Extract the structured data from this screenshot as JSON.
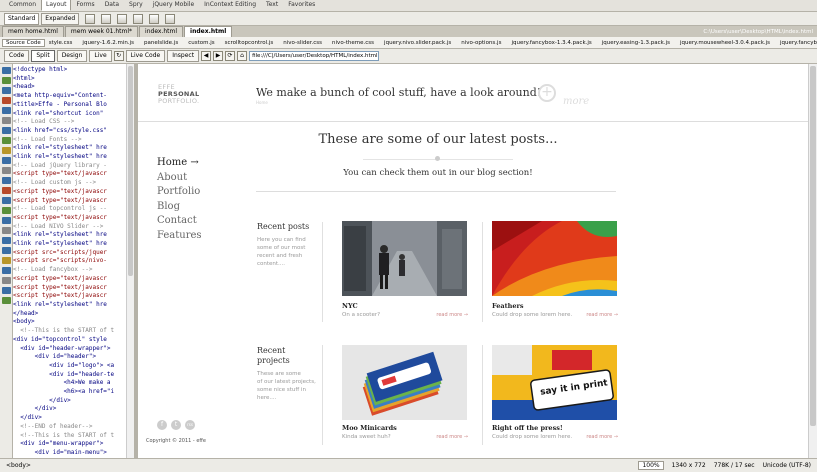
{
  "insert_bar": {
    "tabs": [
      "Common",
      "Layout",
      "Forms",
      "Data",
      "Spry",
      "jQuery Mobile",
      "InContext Editing",
      "Text",
      "Favorites"
    ],
    "active": 1
  },
  "toolrow": {
    "standard": "Standard",
    "expanded": "Expanded"
  },
  "document_tabs": {
    "tabs": [
      "mem home.html",
      "mem week 01.html*",
      "index.html",
      "index.html"
    ],
    "active": 3,
    "path": "C:\\Users\\user\\Desktop\\HTML\\index.html"
  },
  "related_files": [
    "Source Code",
    "style.css",
    "jquery-1.6.2.min.js",
    "panelslide.js",
    "custom.js",
    "scrolltopcontrol.js",
    "nivo-slider.css",
    "nivo-theme.css",
    "jquery.nivo.slider.pack.js",
    "nivo-options.js",
    "jquery.fancybox-1.3.4.pack.js",
    "jquery.easing-1.3.pack.js",
    "jquery.mousewheel-3.0.4.pack.js",
    "jquery.fancybox-1.3.4.css"
  ],
  "doc_toolbar": {
    "code": "Code",
    "split": "Split",
    "design": "Design",
    "live": "Live",
    "live_code": "Live Code",
    "inspect": "Inspect",
    "address": "file:///C|/Users/user/Desktop/HTML/index.html"
  },
  "code_lines": [
    {
      "t": "<!doctype html>",
      "c": "tag"
    },
    {
      "t": "<html>",
      "c": "tag"
    },
    {
      "t": "<head>",
      "c": "tag"
    },
    {
      "t": "<meta http-equiv=\"Content-",
      "c": "tag"
    },
    {
      "t": "<title>Effe - Personal Blo",
      "c": "tag"
    },
    {
      "t": "<link rel=\"shortcut icon\" ",
      "c": "tag"
    },
    {
      "t": "<!-- Load CSS -->",
      "c": "cmt"
    },
    {
      "t": "<link href=\"css/style.css\"",
      "c": "tag"
    },
    {
      "t": "<!-- Load Fonts -->",
      "c": "cmt"
    },
    {
      "t": "<link rel=\"stylesheet\" hre",
      "c": "tag"
    },
    {
      "t": "<link rel=\"stylesheet\" hre",
      "c": "tag"
    },
    {
      "t": "<!-- Load jQuery library -",
      "c": "cmt"
    },
    {
      "t": "<script type=\"text/javascr",
      "c": "red"
    },
    {
      "t": "<!-- Load custom js -->",
      "c": "cmt"
    },
    {
      "t": "<script type=\"text/javascr",
      "c": "red"
    },
    {
      "t": "<script type=\"text/javascr",
      "c": "red"
    },
    {
      "t": "<!-- Load topcontrol js --",
      "c": "cmt"
    },
    {
      "t": "<script type=\"text/javascr",
      "c": "red"
    },
    {
      "t": "<!-- Load NIVO Slider -->",
      "c": "cmt"
    },
    {
      "t": "<link rel=\"stylesheet\" hre",
      "c": "tag"
    },
    {
      "t": "<link rel=\"stylesheet\" hre",
      "c": "tag"
    },
    {
      "t": "<script src=\"scripts/jquer",
      "c": "red"
    },
    {
      "t": "<script src=\"scripts/nivo-",
      "c": "red"
    },
    {
      "t": "<!-- Load fancybox -->",
      "c": "cmt"
    },
    {
      "t": "<script type=\"text/javascr",
      "c": "red"
    },
    {
      "t": "<script type=\"text/javascr",
      "c": "red"
    },
    {
      "t": "<script type=\"text/javascr",
      "c": "red"
    },
    {
      "t": "<link rel=\"stylesheet\" hre",
      "c": "tag"
    },
    {
      "t": "</head>",
      "c": "tag"
    },
    {
      "t": "<body>",
      "c": "tag"
    },
    {
      "t": "  <!--This is the START of t",
      "c": "cmt"
    },
    {
      "t": "<div id=\"topcontrol\" style",
      "c": "tag"
    },
    {
      "t": "  <div id=\"header-wrapper\">",
      "c": "tag"
    },
    {
      "t": "      <div id=\"header\">",
      "c": "tag"
    },
    {
      "t": "          <div id=\"logo\"> <a",
      "c": "tag"
    },
    {
      "t": "          <div id=\"header-te",
      "c": "tag"
    },
    {
      "t": "              <h4>We make a ",
      "c": "tag"
    },
    {
      "t": "              <h6><a href=\"i",
      "c": "tag"
    },
    {
      "t": "          </div>",
      "c": "tag"
    },
    {
      "t": "      </div>",
      "c": "tag"
    },
    {
      "t": "  </div>",
      "c": "tag"
    },
    {
      "t": "  <!--END of header-->",
      "c": "cmt"
    },
    {
      "t": "  <!--This is the START of t",
      "c": "cmt"
    },
    {
      "t": "  <div id=\"menu-wrapper\">",
      "c": "tag"
    },
    {
      "t": "      <div id=\"main-menu\">",
      "c": "tag"
    }
  ],
  "site": {
    "logo": [
      "EFFE",
      "PERSONAL",
      "PORTFOLIO."
    ],
    "tagline": "We make a bunch of cool stuff, have a look around!",
    "tagline_sub": "Home",
    "more": "more",
    "heading": "These are some of our latest posts...",
    "subheading": "You can check them out in our blog section!",
    "nav": [
      "Home →",
      "About",
      "Portfolio",
      "Blog",
      "Contact",
      "Features"
    ],
    "recent_posts": {
      "title": "Recent posts",
      "desc": [
        "Here you can find",
        "some of our most",
        "recent and fresh",
        "content...."
      ]
    },
    "recent_projects": {
      "title": [
        "Recent",
        "projects"
      ],
      "desc": [
        "These are some",
        "of our latest projects,",
        "some nice stuff in",
        "here...."
      ]
    },
    "posts": [
      {
        "title": "NYC",
        "desc": "On a scooter?",
        "more": "read more →"
      },
      {
        "title": "Feathers",
        "desc": "Could drop some lorem here.",
        "more": "read more →"
      }
    ],
    "projects": [
      {
        "title": "Moo Minicards",
        "desc": "Kinda sweet huh?",
        "more": "read more →"
      },
      {
        "title": "Right off the press!",
        "desc": "Could drop some lorem here.",
        "more": "read more →"
      }
    ],
    "card_text": "say it in print",
    "social": [
      "f",
      "t",
      "rss"
    ],
    "copyright": "Copyright © 2011 - effe"
  },
  "status": {
    "tag": "<body>",
    "zoom": "100%",
    "dims": "1340 x 772",
    "size": "778K / 17 sec",
    "encoding": "Unicode (UTF-8)"
  },
  "colors": {
    "chrome": "#d4d0c8",
    "code_tag": "#000080",
    "code_comment": "#888888",
    "code_script": "#8b0000"
  }
}
